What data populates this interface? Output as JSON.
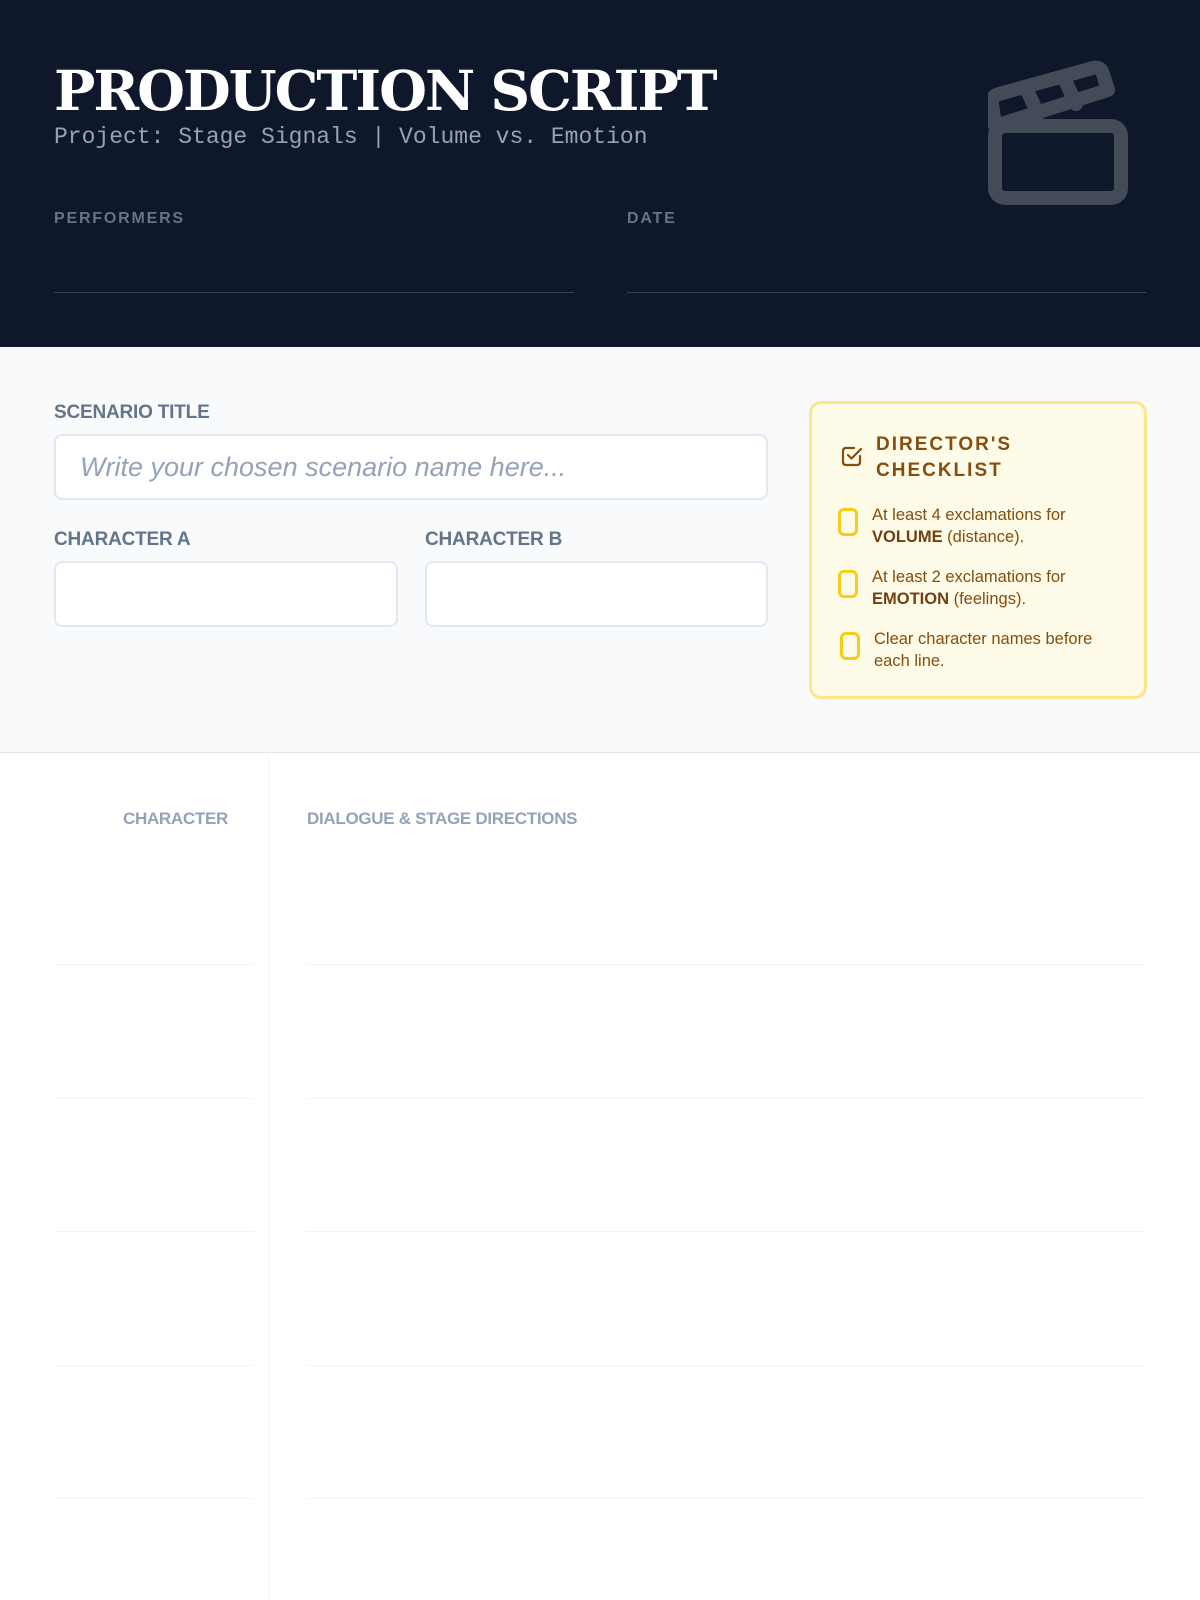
{
  "header": {
    "title": "PRODUCTION SCRIPT",
    "subtitle": "Project: Stage Signals | Volume vs. Emotion",
    "performers_label": "PERFORMERS",
    "date_label": "DATE",
    "icon": "clapperboard-icon"
  },
  "setup": {
    "scenario_label": "SCENARIO TITLE",
    "scenario_placeholder": "Write your chosen scenario name here...",
    "character_a_label": "CHARACTER A",
    "character_b_label": "CHARACTER B"
  },
  "checklist": {
    "title": "DIRECTOR'S CHECKLIST",
    "icon": "square-check-icon",
    "items": [
      {
        "pre": "At least 4 exclamations for ",
        "strong": "VOLUME",
        "post": " (distance)."
      },
      {
        "pre": "At least 2 exclamations for ",
        "strong": "EMOTION",
        "post": " (feelings)."
      },
      {
        "pre": "Clear character names before each line.",
        "strong": "",
        "post": ""
      }
    ]
  },
  "script": {
    "character_header": "CHARACTER",
    "dialogue_header": "DIALOGUE & STAGE DIRECTIONS"
  },
  "colors": {
    "header_bg": "#0f172a",
    "checklist_bg": "#fefce8",
    "checklist_border": "#fde68a",
    "checklist_text": "#854d0e",
    "checkbox_border": "#facc15"
  }
}
